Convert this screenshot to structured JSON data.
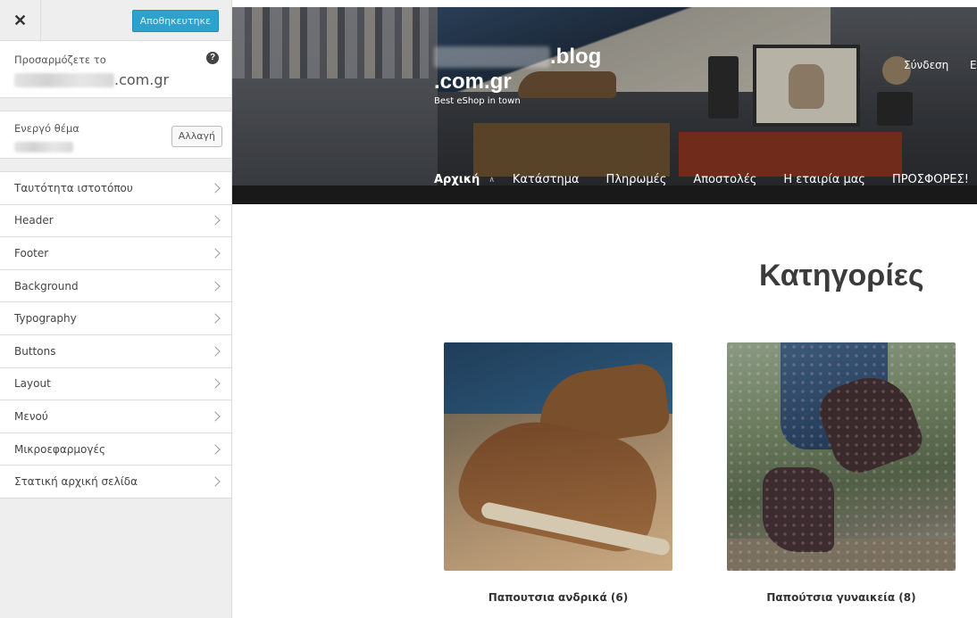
{
  "sidebar": {
    "save_label": "Αποθηκευτηκε",
    "customizing_label": "Προσαρμόζετε το",
    "site_domain_suffix": ".com.gr",
    "active_theme_label": "Ενεργό θέμα",
    "change_label": "Αλλαγή",
    "menu": [
      {
        "label": "Ταυτότητα ιστοτόπου"
      },
      {
        "label": "Header"
      },
      {
        "label": "Footer"
      },
      {
        "label": "Background"
      },
      {
        "label": "Typography"
      },
      {
        "label": "Buttons"
      },
      {
        "label": "Layout"
      },
      {
        "label": "Μενού"
      },
      {
        "label": "Μικροεφαρμογές"
      },
      {
        "label": "Στατική αρχική σελίδα"
      }
    ]
  },
  "preview": {
    "brand_suffix": ".blog",
    "brand_tld": ".com.gr",
    "tagline": "Best eShop in town",
    "login": "Σύνδεση",
    "login_extra": "Ε",
    "nav": {
      "active": "Αρχική",
      "items": [
        "Κατάστημα",
        "Πληρωμές",
        "Αποστολές",
        "Η εταιρία μας",
        "ΠΡΟΣΦΟΡΕΣ!"
      ]
    },
    "heading": "Κατηγορίες",
    "products": [
      {
        "caption": "Παπουτσια ανδρικά (6)"
      },
      {
        "caption": "Παπούτσια γυναικεία (8)"
      }
    ]
  }
}
